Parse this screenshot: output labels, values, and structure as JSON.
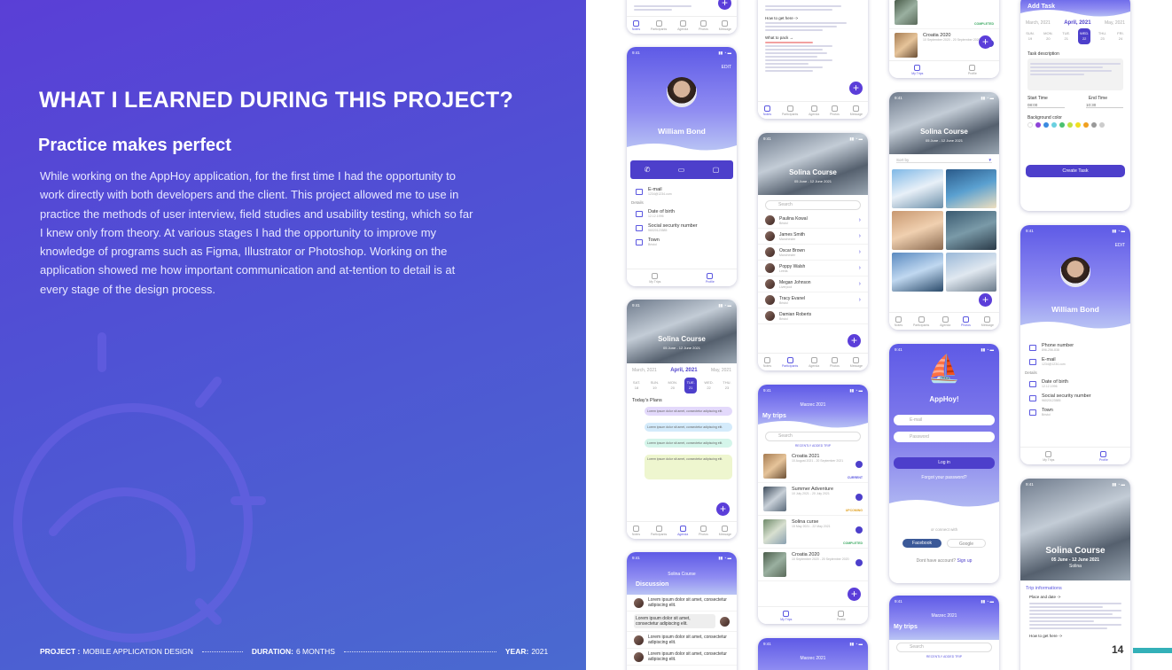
{
  "slide": {
    "heading": "WHAT I LEARNED DURING THIS PROJECT?",
    "subheading": "Practice makes perfect",
    "paragraph": "While working on the AppHoy application, for the first time I had the opportunity to work directly with both developers and the client. This project allowed me to use in practice the methods of user interview, field studies and usability testing, which so far I knew only from theory. At various stages I had the opportunity to improve my knowledge of programs such as Figma, Illustrator or Photoshop. Working on the application showed me how important communication and at-tention to detail is at every stage of the design process.",
    "page_number": "14",
    "colors": {
      "background_gradient_start": "#5a3fd6",
      "accent": "#4d3fcb",
      "teal_bar": "#33b0b8"
    }
  },
  "footer": {
    "project_label": "PROJECT :",
    "project_value": "MOBILE APPLICATION DESIGN",
    "duration_label": "DURATION:",
    "duration_value": "6 MONTHS",
    "year_label": "YEAR:",
    "year_value": "2021"
  },
  "app": {
    "time": "9:41",
    "tabs": [
      "Notes",
      "Participants",
      "Agenda",
      "Photos",
      "Message"
    ],
    "tabs_short": [
      "My Trips",
      "Profile"
    ],
    "profile": {
      "name": "William Bond",
      "edit": "EDIT",
      "email_label": "E-mail",
      "email_value": "1234@1234.com",
      "phone_label": "Phone number",
      "phone_value": "896-256-838",
      "details": "Details",
      "dob_label": "Date of birth",
      "dob_value": "12.12.1996",
      "ssn_label": "Social security number",
      "ssn_value": "96020123585",
      "town_label": "Town",
      "town_value": "Bristol"
    },
    "course": {
      "title": "Solina Course",
      "dates": "05 June - 12 June 2021",
      "place": "Solina"
    },
    "agenda": {
      "months": [
        "March, 2021",
        "April, 2021",
        "May, 2021"
      ],
      "days": [
        [
          "SAT.",
          "18"
        ],
        [
          "SUN.",
          "19"
        ],
        [
          "MON.",
          "20"
        ],
        [
          "TUE.",
          "21"
        ],
        [
          "WED.",
          "22"
        ],
        [
          "THU.",
          "23"
        ]
      ],
      "today": "Today's Plans",
      "plan_text": "Lorem ipsum dolor sit amet, consectetur adipiscing elit."
    },
    "participants": {
      "search": "Search",
      "people": [
        [
          "Paulina Kowal",
          "Bristol"
        ],
        [
          "James Smith",
          "Manchester"
        ],
        [
          "Oscar Brown",
          "Manchester"
        ],
        [
          "Poppy Walsh",
          "Leeds"
        ],
        [
          "Megan Johnson",
          "Liverpool"
        ],
        [
          "Tracy Evanel",
          "Bristol"
        ],
        [
          "Damian Roberts",
          "Bristol"
        ]
      ]
    },
    "trips": {
      "title": "My trips",
      "month": "Marzec 2021",
      "recent": "RECENTLY ADDED TRIP",
      "items": [
        [
          "Croatia 2021",
          "10 August 2021 - 20 September 2021",
          "CURRENT",
          "#5b57e0"
        ],
        [
          "Summer Adventure",
          "10 July 2021 - 20 July 2021",
          "UPCOMING",
          "#e0a020"
        ],
        [
          "Solina curse",
          "15 May 2021 - 22 May 2021",
          "COMPLETED",
          "#3aa860"
        ],
        [
          "Croatia 2020",
          "10 September 2020 - 20 September 2020",
          "COMPLETED",
          "#3aa860"
        ]
      ]
    },
    "discussion": {
      "title": "Discussion",
      "msg": "Lorem ipsum dolor sit amet, consectetur adipiscing elit."
    },
    "photos": {
      "sort": "Sort by"
    },
    "login": {
      "brand": "AppHoy!",
      "email": "E-mail",
      "password": "Password",
      "login": "Log in",
      "forgot": "Forgot your password?",
      "connect": "or connect with",
      "facebook": "Facebook",
      "google": "Google",
      "no_account": "Dont have account?",
      "signup": "Sign up"
    },
    "task": {
      "title": "Add Task",
      "months": [
        "March, 2021",
        "April, 2021",
        "May, 2021"
      ],
      "days": [
        [
          "SUN.",
          "19"
        ],
        [
          "MON.",
          "20"
        ],
        [
          "TUE.",
          "21"
        ],
        [
          "WED.",
          "22"
        ],
        [
          "THU.",
          "23"
        ],
        [
          "FRI.",
          "24"
        ]
      ],
      "desc": "Task description",
      "start": "Start Time",
      "start_val": "08:00",
      "end": "End Time",
      "end_val": "10:30",
      "bg": "Background color",
      "button": "Create Task"
    },
    "trip_info": {
      "label": "Trip informations",
      "place": "Place and date ->",
      "how": "How to get here ->"
    }
  }
}
